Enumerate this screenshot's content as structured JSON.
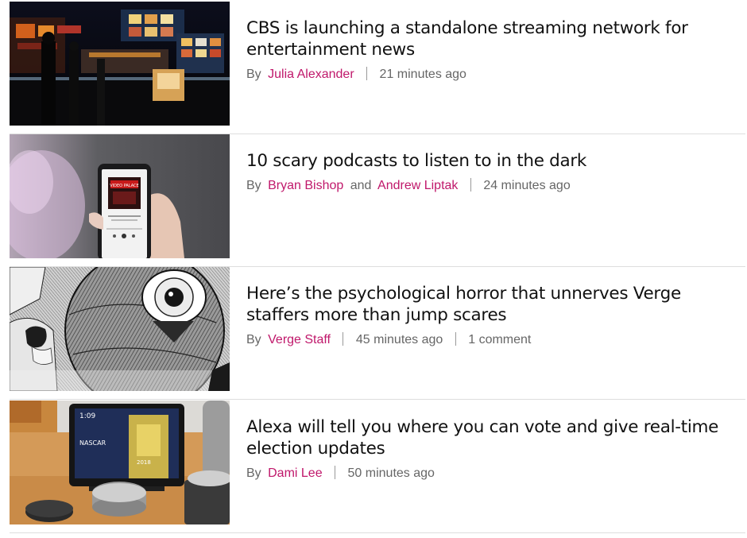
{
  "articles": [
    {
      "title": "CBS is launching a standalone streaming network for entertainment news",
      "by": "By",
      "authors": [
        "Julia Alexander"
      ],
      "time": "21 minutes ago"
    },
    {
      "title": "10 scary podcasts to listen to in the dark",
      "by": "By",
      "authors": [
        "Bryan Bishop",
        "Andrew Liptak"
      ],
      "author_joiner": "and",
      "time": "24 minutes ago",
      "phone_screen_text": "VIDEO PALACE"
    },
    {
      "title": "Here’s the psychological horror that unnerves Verge staffers more than jump scares",
      "by": "By",
      "authors": [
        "Verge Staff"
      ],
      "time": "45 minutes ago",
      "comments": "1 comment"
    },
    {
      "title": "Alexa will tell you where you can vote and give real-time election updates",
      "by": "By",
      "authors": [
        "Dami Lee"
      ],
      "time": "50 minutes ago",
      "device_screen_time": "1:09",
      "device_screen_text": "NASCAR",
      "device_screen_year": "2018"
    }
  ],
  "colors": {
    "author_link": "#c0186b",
    "title": "#111111",
    "meta": "#666666",
    "divider": "#dedede"
  }
}
